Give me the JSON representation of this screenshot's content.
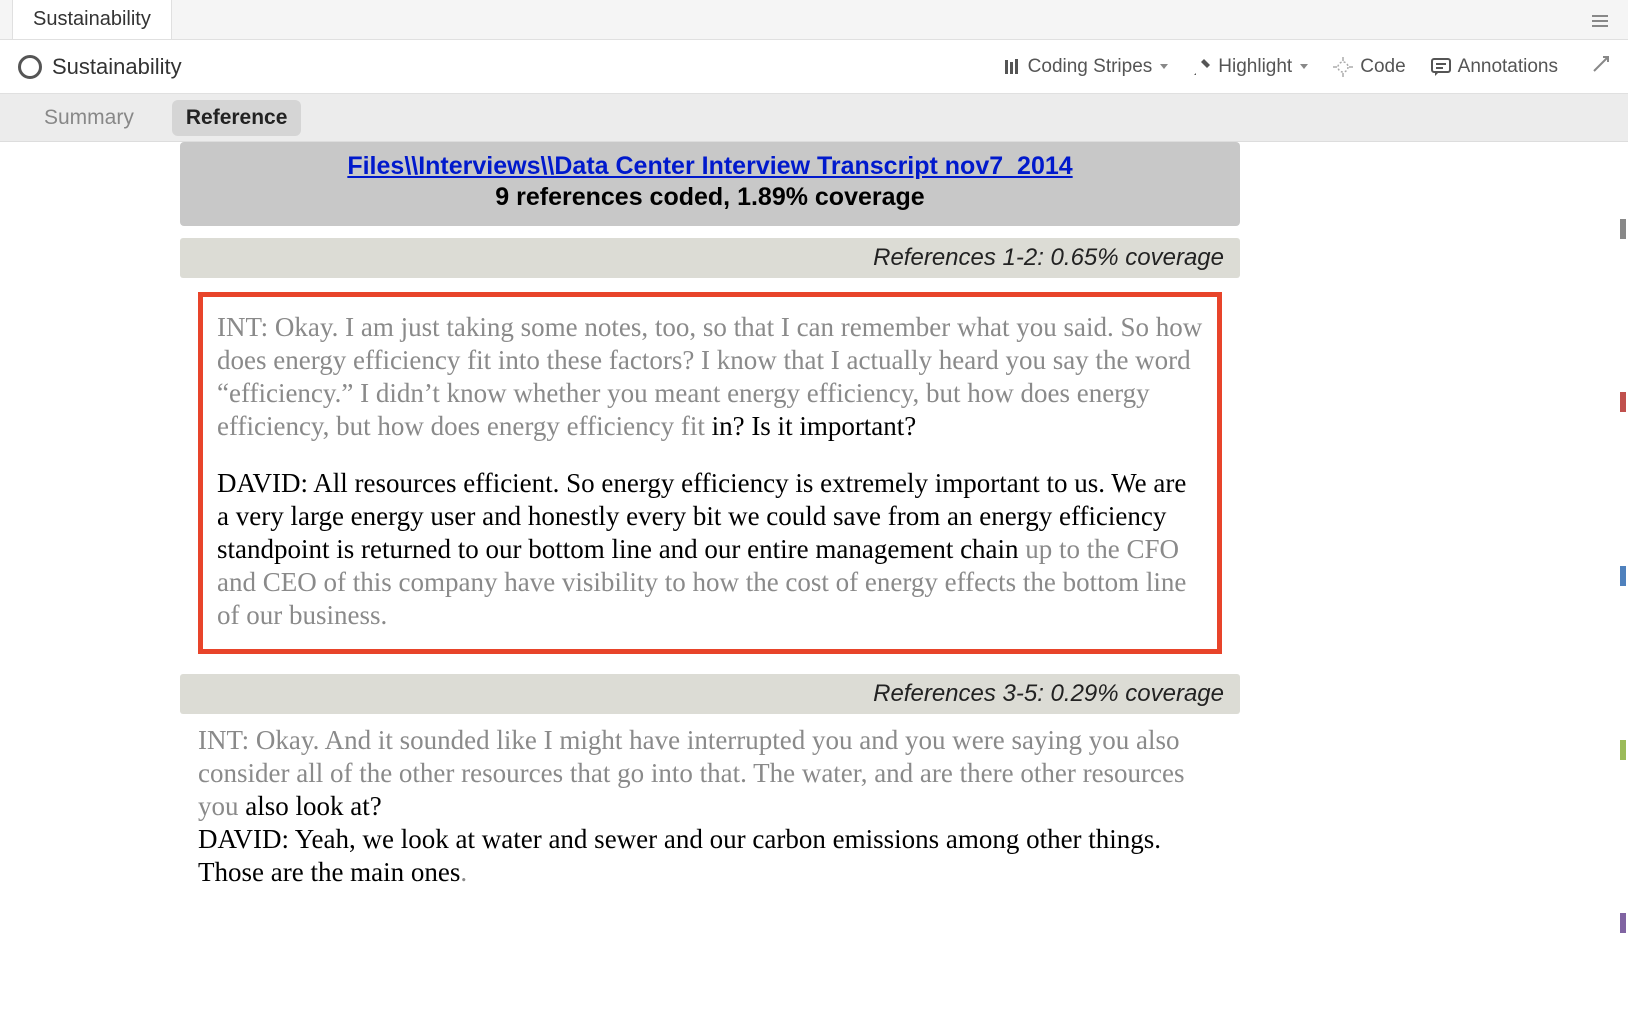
{
  "tab": {
    "label": "Sustainability"
  },
  "header": {
    "title": "Sustainability"
  },
  "toolbar": {
    "codingStripes": "Coding Stripes",
    "highlight": "Highlight",
    "code": "Code",
    "annotations": "Annotations"
  },
  "subtabs": {
    "summary": "Summary",
    "reference": "Reference"
  },
  "fileHeader": {
    "path": "Files\\\\Interviews\\\\Data Center Interview Transcript nov7_2014",
    "stats": "9 references coded, 1.89% coverage"
  },
  "ref1": {
    "label": "References 1-2: 0.65% coverage",
    "p1_gray": "INT:  Okay. I am just taking some notes, too, so that I can remember what you said. So how does energy efficiency fit into these factors? I know that I actually heard you say the word “efficiency.”  I didn’t know whether you meant energy efficiency, but how does energy efficiency, but how does energy efficiency fit ",
    "p1_black": "in?  Is it important?",
    "p2_black": "DAVID:  All resources efficient. So energy efficiency is extremely important to us. We are a very large energy user and honestly every bit we could save from an energy efficiency standpoint is returned to our bottom line and our entire management chain ",
    "p2_gray": "up to the CFO and CEO of this company have visibility to how the cost of energy effects the bottom line of our business."
  },
  "ref2": {
    "label": "References 3-5: 0.29% coverage",
    "p1_gray": "INT:  Okay. And it sounded like I might have interrupted you and you were saying you also consider all of the other resources that go into that. The water, and are there other resources you ",
    "p1_black": "also look at?",
    "p2_black": "DAVID:  Yeah, we look at water and sewer and our carbon emissions among other things. Those are the main ones",
    "p2_gray": "."
  }
}
